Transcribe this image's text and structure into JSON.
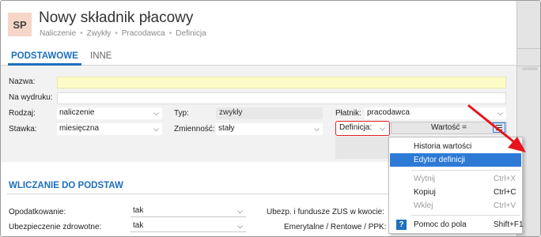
{
  "header": {
    "avatar": "SP",
    "title": "Nowy składnik płacowy",
    "breadcrumbs": [
      "Naliczenie",
      "Zwykły",
      "Pracodawca",
      "Definicja"
    ],
    "separator": "•"
  },
  "tabs": [
    {
      "label": "PODSTAWOWE",
      "active": true
    },
    {
      "label": "INNE",
      "active": false
    }
  ],
  "form": {
    "nazwa_label": "Nazwa:",
    "nazwa_value": "",
    "na_wydruku_label": "Na wydruku:",
    "na_wydruku_value": "",
    "rodzaj_label": "Rodzaj:",
    "rodzaj_value": "naliczenie",
    "typ_label": "Typ:",
    "typ_value": "zwykły",
    "platnik_label": "Płatnik:",
    "platnik_value": "pracodawca",
    "stawka_label": "Stawka:",
    "stawka_value": "miesięczna",
    "zmiennosc_label": "Zmienność:",
    "zmiennosc_value": "stały",
    "definicja_value": "Definicja:",
    "wartosc_label": "Wartość ="
  },
  "section": {
    "title": "WLICZANIE DO PODSTAW",
    "opodatkowanie_label": "Opodatkowanie:",
    "opodatkowanie_value": "tak",
    "zdrowotne_label": "Ubezpieczenie zdrowotne:",
    "zdrowotne_value": "tak",
    "zus_label": "Ubezp. i fundusze ZUS w kwocie:",
    "emerytalne_label": "Emerytalne / Rentowe / PPK:"
  },
  "context_menu": {
    "items": [
      {
        "label": "Historia wartości",
        "shortcut": "",
        "state": "normal"
      },
      {
        "label": "Edytor definicji",
        "shortcut": "",
        "state": "highlighted"
      },
      {
        "label": "Wytnij",
        "shortcut": "Ctrl+X",
        "state": "disabled"
      },
      {
        "label": "Kopiuj",
        "shortcut": "Ctrl+C",
        "state": "normal"
      },
      {
        "label": "Wklej",
        "shortcut": "Ctrl+V",
        "state": "disabled"
      },
      {
        "label": "Pomoc do pola",
        "shortcut": "Shift+F1",
        "state": "normal"
      }
    ],
    "help_icon": "?"
  },
  "colors": {
    "accent": "#1e6fbf",
    "highlight": "#2d7ad6",
    "arrow": "#e8141b",
    "required_field": "#fdfcc9"
  }
}
